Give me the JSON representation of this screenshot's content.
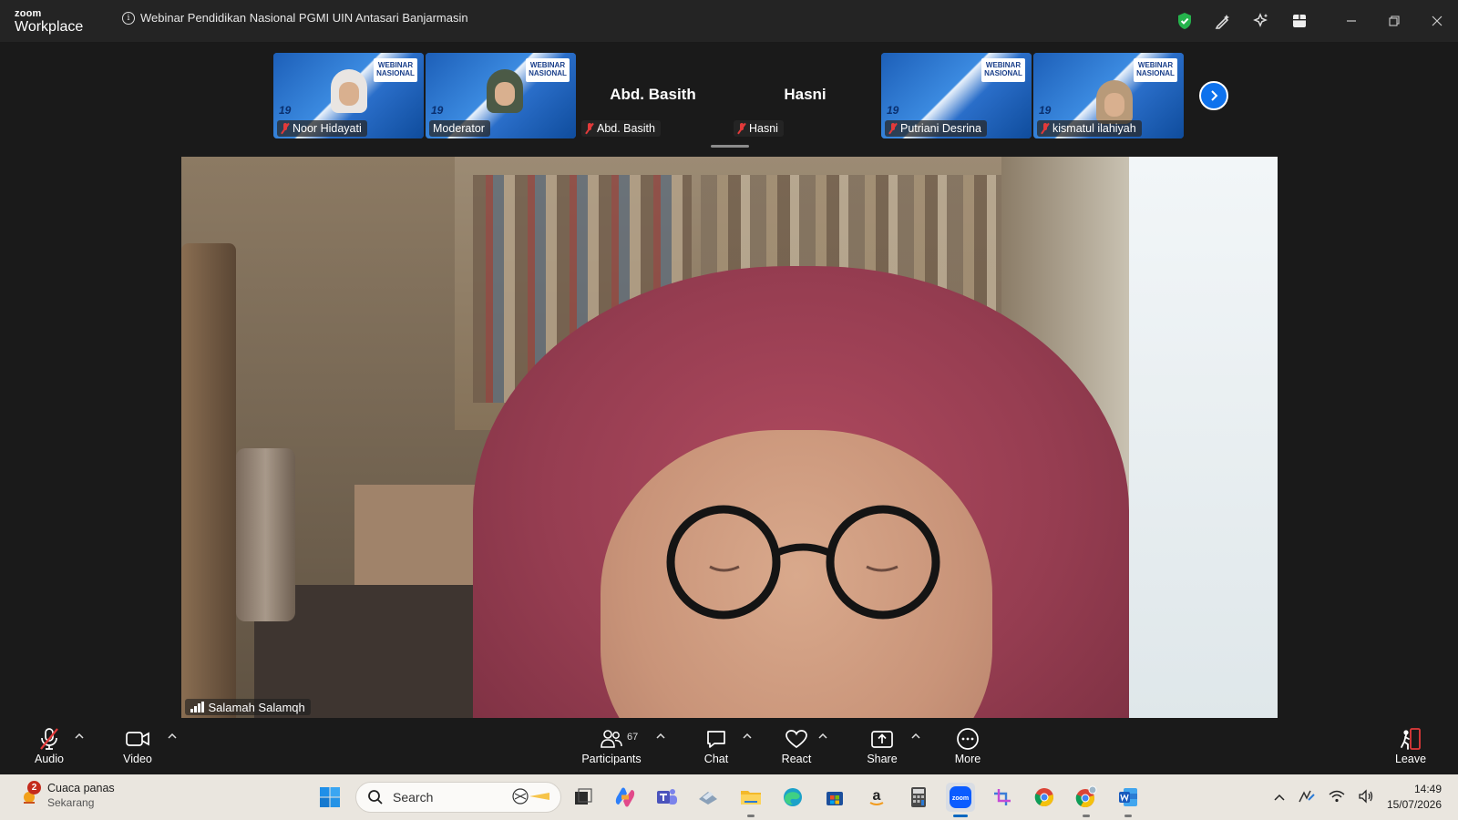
{
  "app": {
    "brand_top": "zoom",
    "brand_bottom": "Workplace",
    "meeting_title": "Webinar Pendidikan Nasional PGMI UIN Antasari Banjarmasin"
  },
  "titlebar_icons": [
    "shield-check-icon",
    "annotate-icon",
    "ai-companion-icon",
    "apps-icon"
  ],
  "colors": {
    "accent": "#0e72ed",
    "muted_red": "#e23a3a",
    "security_green": "#25b34c",
    "banner_blue": "#1d5fb8"
  },
  "filmstrip": {
    "tiles": [
      {
        "name": "Noor Hidayati",
        "type": "video",
        "banner": "WEBINAR NASIONAL",
        "muted": true
      },
      {
        "name": "Moderator",
        "type": "video",
        "banner": "WEBINAR NASIONAL",
        "muted": false
      },
      {
        "name": "Abd. Basith",
        "type": "name",
        "display": "Abd. Basith",
        "muted": true
      },
      {
        "name": "Hasni",
        "type": "name",
        "display": "Hasni",
        "muted": true
      },
      {
        "name": "Putriani Desrina",
        "type": "video",
        "banner": "WEBINAR NASIONAL",
        "muted": true
      },
      {
        "name": "kismatul ilahiyah",
        "type": "video",
        "banner": "WEBINAR NASIONAL",
        "muted": true
      }
    ],
    "logo_text": "19"
  },
  "speaker": {
    "name": "Salamah Salamqh"
  },
  "controls": {
    "audio": "Audio",
    "video": "Video",
    "participants": "Participants",
    "participants_count": "67",
    "chat": "Chat",
    "react": "React",
    "share": "Share",
    "more": "More",
    "leave": "Leave"
  },
  "taskbar": {
    "weather_title": "Cuaca panas",
    "weather_sub": "Sekarang",
    "weather_badge": "2",
    "search_placeholder": "Search",
    "time": "14:49",
    "date": "15/07/2026",
    "apps": [
      "start-icon",
      "search",
      "task-view-icon",
      "copilot-icon",
      "teams-icon",
      "printer-app-icon",
      "file-explorer-icon",
      "edge-icon",
      "store-icon",
      "amazon-icon",
      "calculator-icon",
      "zoom-app-icon",
      "snipping-tool-icon",
      "chrome-icon",
      "chrome-profile-icon",
      "word-icon"
    ]
  }
}
